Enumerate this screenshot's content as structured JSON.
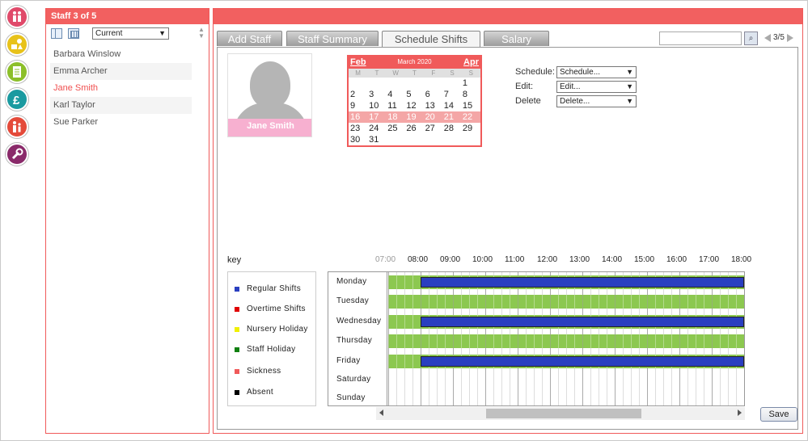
{
  "staff_panel": {
    "title": "Staff 3 of 5",
    "filter": "Current",
    "staff": [
      {
        "name": "Barbara Winslow",
        "selected": false
      },
      {
        "name": "Emma Archer",
        "selected": false
      },
      {
        "name": "Jane Smith",
        "selected": true
      },
      {
        "name": "Karl Taylor",
        "selected": false
      },
      {
        "name": "Sue Parker",
        "selected": false
      }
    ]
  },
  "tabs": [
    {
      "label": "Add Staff",
      "active": false
    },
    {
      "label": "Staff Summary",
      "active": false
    },
    {
      "label": "Schedule Shifts",
      "active": true
    },
    {
      "label": "Salary",
      "active": false
    }
  ],
  "search": {
    "value": "",
    "placeholder": ""
  },
  "pager": {
    "label": "3/5"
  },
  "profile": {
    "name": "Jane Smith"
  },
  "calendar": {
    "prev": "Feb",
    "next": "Apr",
    "title": "March 2020",
    "dow": [
      "M",
      "T",
      "W",
      "T",
      "F",
      "S",
      "S"
    ],
    "weeks": [
      [
        "",
        "",
        "",
        "",
        "",
        "",
        "1"
      ],
      [
        "2",
        "3",
        "4",
        "5",
        "6",
        "7",
        "8"
      ],
      [
        "9",
        "10",
        "11",
        "12",
        "13",
        "14",
        "15"
      ],
      [
        "16",
        "17",
        "18",
        "19",
        "20",
        "21",
        "22"
      ],
      [
        "23",
        "24",
        "25",
        "26",
        "27",
        "28",
        "29"
      ],
      [
        "30",
        "31",
        "",
        "",
        "",
        "",
        ""
      ]
    ],
    "highlighted_week": 3
  },
  "actions": {
    "schedule_label": "Schedule:",
    "schedule_value": "Schedule...",
    "edit_label": "Edit:",
    "edit_value": "Edit...",
    "delete_label": "Delete",
    "delete_value": "Delete..."
  },
  "key": {
    "title": "key",
    "items": [
      {
        "label": "Regular Shifts",
        "color": "#2a3fc0"
      },
      {
        "label": "Overtime Shifts",
        "color": "#e00000"
      },
      {
        "label": "Nursery Holiday",
        "color": "#f0f000"
      },
      {
        "label": "Staff Holiday",
        "color": "#108010"
      },
      {
        "label": "Sickness",
        "color": "#f05a5a"
      },
      {
        "label": "Absent",
        "color": "#000000"
      }
    ]
  },
  "schedule": {
    "times": [
      "07:00",
      "08:00",
      "09:00",
      "10:00",
      "11:00",
      "12:00",
      "13:00",
      "14:00",
      "15:00",
      "16:00",
      "17:00",
      "18:00"
    ],
    "days": [
      {
        "day": "Monday",
        "available": true,
        "shift": {
          "start": "08:00",
          "end": "18:00"
        }
      },
      {
        "day": "Tuesday",
        "available": true,
        "shift": null
      },
      {
        "day": "Wednesday",
        "available": true,
        "shift": {
          "start": "08:00",
          "end": "18:00"
        }
      },
      {
        "day": "Thursday",
        "available": true,
        "shift": null
      },
      {
        "day": "Friday",
        "available": true,
        "shift": {
          "start": "08:00",
          "end": "18:00"
        }
      },
      {
        "day": "Saturday",
        "available": false,
        "shift": null
      },
      {
        "day": "Sunday",
        "available": false,
        "shift": null
      }
    ]
  },
  "save_label": "Save"
}
